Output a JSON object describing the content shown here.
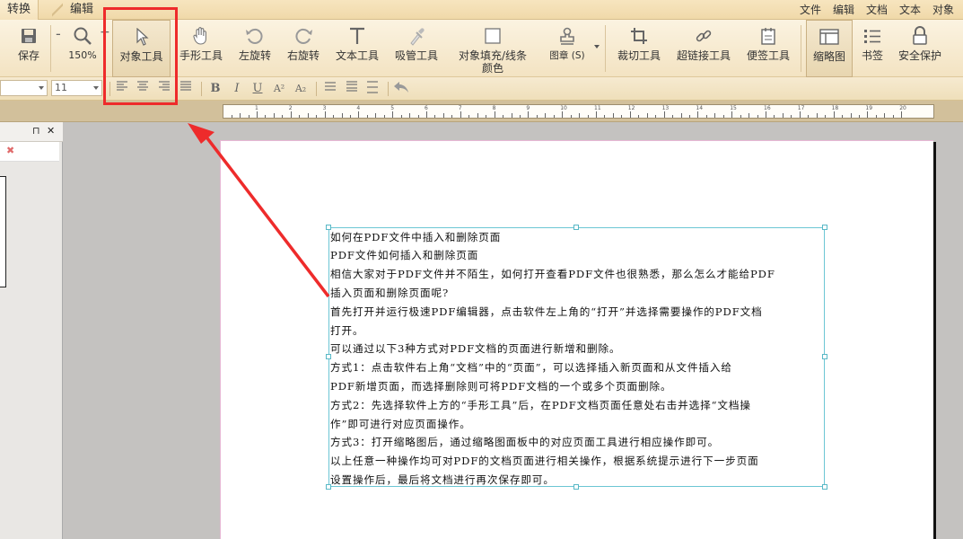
{
  "tabs": [
    {
      "label": "转换",
      "active": true
    },
    {
      "label": "编辑",
      "active": false
    }
  ],
  "menu": [
    "文件",
    "编辑",
    "文档",
    "文本",
    "对象"
  ],
  "ribbon": {
    "save_label": "保存",
    "zoom_value": "150%",
    "zoom_out_label": "-",
    "zoom_in_label": "+",
    "tools": [
      {
        "label": "对象工具",
        "icon": "cursor-icon",
        "selected": true
      },
      {
        "label": "手形工具",
        "icon": "hand-icon"
      },
      {
        "label": "左旋转",
        "icon": "rotate-left-icon"
      },
      {
        "label": "右旋转",
        "icon": "rotate-right-icon"
      },
      {
        "label": "文本工具",
        "icon": "text-tool-icon"
      },
      {
        "label": "吸管工具",
        "icon": "eyedropper-icon"
      },
      {
        "label": "对象填充/线条颜色",
        "icon": "fill-color-icon"
      },
      {
        "label": "图章 (S)",
        "icon": "stamp-icon"
      },
      {
        "label": "裁切工具",
        "icon": "crop-icon"
      },
      {
        "label": "超链接工具",
        "icon": "link-icon"
      },
      {
        "label": "便签工具",
        "icon": "note-icon"
      },
      {
        "label": "缩略图",
        "icon": "thumbnail-icon",
        "selected": true
      },
      {
        "label": "书签",
        "icon": "bookmark-list-icon"
      },
      {
        "label": "安全保护",
        "icon": "lock-icon"
      }
    ]
  },
  "format": {
    "font_size": "11",
    "buttons": [
      "B",
      "I",
      "U",
      "A²",
      "A₂"
    ]
  },
  "ruler": {
    "numbers": [
      "1",
      "2",
      "3",
      "4",
      "5",
      "6",
      "7",
      "8",
      "9",
      "10",
      "11",
      "12",
      "13",
      "14",
      "15",
      "16",
      "17",
      "18",
      "19",
      "20"
    ]
  },
  "panel": {
    "pin": "⊓",
    "close": "✕"
  },
  "document": {
    "lines": [
      "如何在PDF文件中插入和删除页面",
      "PDF文件如何插入和删除页面",
      "相信大家对于PDF文件并不陌生，如何打开查看PDF文件也很熟悉，那么怎么才能给PDF",
      "插入页面和删除页面呢?",
      "首先打开并运行极速PDF编辑器，点击软件左上角的“打开”并选择需要操作的PDF文档",
      "打开。",
      "可以通过以下3种方式对PDF文档的页面进行新增和删除。",
      "方式1：点击软件右上角“文档”中的“页面”，可以选择插入新页面和从文件插入给",
      "PDF新增页面，而选择删除则可将PDF文档的一个或多个页面删除。",
      "方式2：先选择软件上方的“手形工具”后，在PDF文档页面任意处右击并选择“文档操",
      "作”即可进行对应页面操作。",
      "方式3：打开缩略图后，通过缩略图面板中的对应页面工具进行相应操作即可。",
      "以上任意一种操作均可对PDF的文档页面进行相关操作，根据系统提示进行下一步页面",
      "设置操作后，最后将文档进行再次保存即可。"
    ]
  },
  "colors": {
    "highlight": "#ee2b2b",
    "ribbon": "#f3e3c2",
    "selection": "#6cc6d4"
  }
}
